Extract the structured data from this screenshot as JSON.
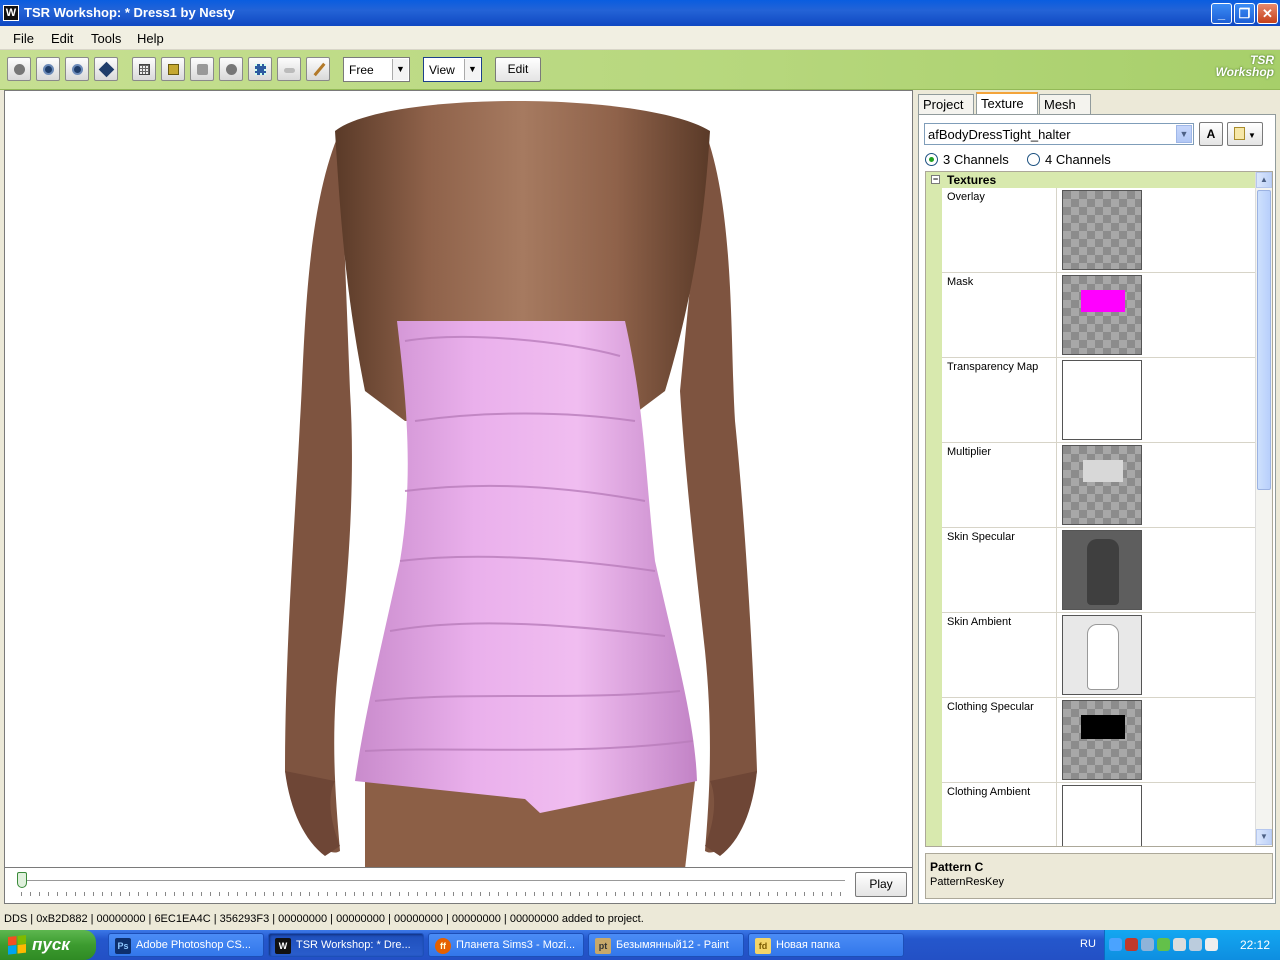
{
  "window": {
    "title": "TSR Workshop: * Dress1 by Nesty",
    "app_icon_letter": "W"
  },
  "menu": [
    "File",
    "Edit",
    "Tools",
    "Help"
  ],
  "toolbar": {
    "mode_combo": "Free",
    "view_combo": "View",
    "edit_label": "Edit",
    "logo_line1": "TSR",
    "logo_line2": "Workshop"
  },
  "viewport": {
    "play_label": "Play",
    "timeline_position": 0
  },
  "panel": {
    "tabs": [
      "Project",
      "Texture",
      "Mesh"
    ],
    "active_tab": "Texture",
    "texture_name": "afBodyDressTight_halter",
    "a_button": "A",
    "channels": [
      {
        "label": "3 Channels",
        "selected": true
      },
      {
        "label": "4 Channels",
        "selected": false
      }
    ],
    "category": "Textures",
    "rows": [
      {
        "label": "Overlay",
        "preview": "checker"
      },
      {
        "label": "Mask",
        "preview": "checker-mask"
      },
      {
        "label": "Transparency Map",
        "preview": "white"
      },
      {
        "label": "Multiplier",
        "preview": "checker-multiplier"
      },
      {
        "label": "Skin Specular",
        "preview": "body-dark"
      },
      {
        "label": "Skin Ambient",
        "preview": "body-light"
      },
      {
        "label": "Clothing Specular",
        "preview": "checker-black"
      },
      {
        "label": "Clothing Ambient",
        "preview": "white"
      }
    ],
    "description_title": "Pattern C",
    "description_text": "PatternResKey"
  },
  "status": "DDS | 0xB2D882 | 00000000 | 6EC1EA4C | 356293F3 | 00000000 | 00000000 | 00000000 | 00000000 | 00000000 added to project.",
  "taskbar": {
    "start_label": "пуск",
    "tasks": [
      {
        "label": "Adobe Photoshop CS...",
        "icon": "Ps"
      },
      {
        "label": "TSR Workshop: * Dre...",
        "icon": "W"
      },
      {
        "label": "Планета Sims3 - Mozi...",
        "icon": "ff"
      },
      {
        "label": "Безымянный12 - Paint",
        "icon": "pt"
      },
      {
        "label": "Новая папка",
        "icon": "fd"
      }
    ],
    "language": "RU",
    "clock": "22:12"
  },
  "colors": {
    "dress": "#e6a4e8",
    "skin": "#9b6d50",
    "mask": "#ff00ff",
    "toolbar_green": "#b6d77c"
  }
}
